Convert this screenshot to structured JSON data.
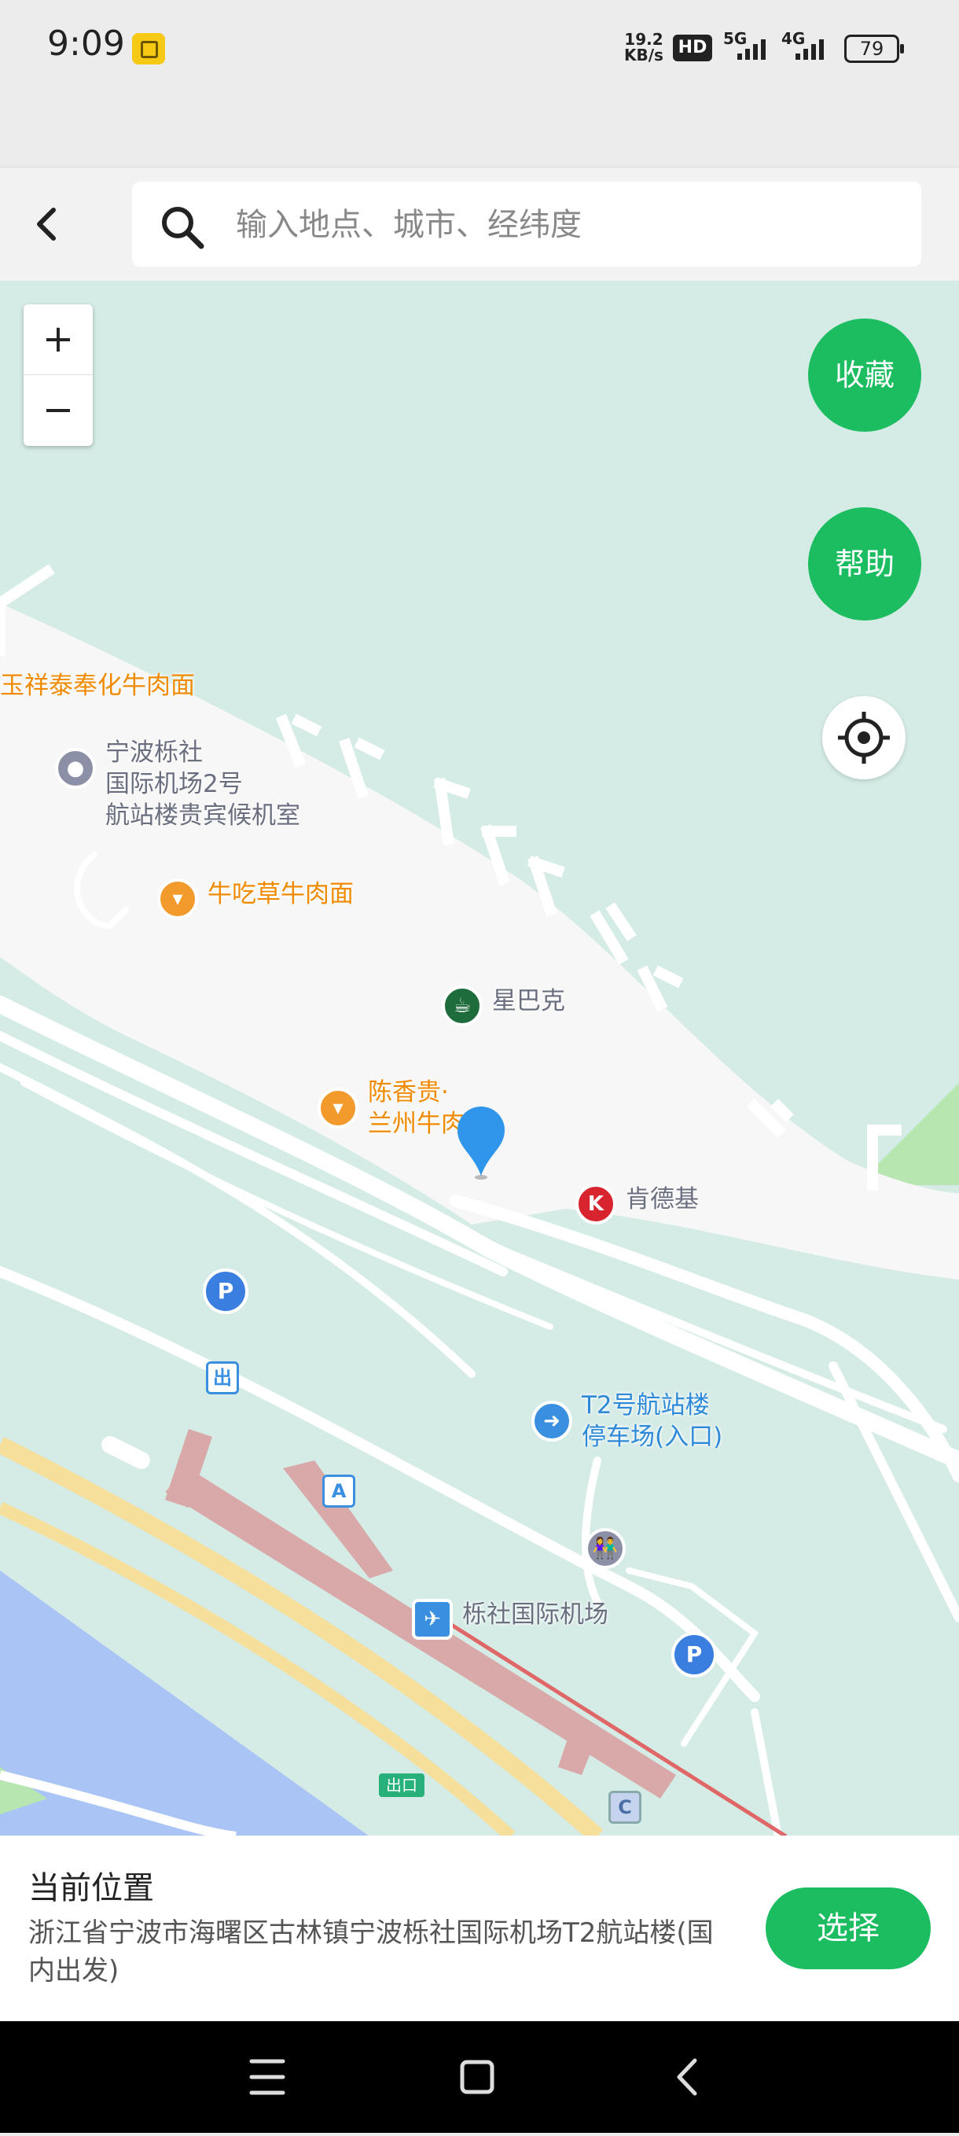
{
  "status_bar": {
    "time": "9:09",
    "net_speed_value": "19.2",
    "net_speed_unit": "KB/s",
    "hd_badge": "HD",
    "signal_1": "5G",
    "signal_2": "4G",
    "battery": "79"
  },
  "header": {
    "search_placeholder": "输入地点、城市、经纬度"
  },
  "map": {
    "zoom_in": "+",
    "zoom_out": "−",
    "favorite_label": "收藏",
    "help_label": "帮助",
    "pois": {
      "yuxiangtai": "玉祥泰奉化牛肉面",
      "vip_lounge": "宁波栎社\n国际机场2号\n航站楼贵宾候机室",
      "niuchicao": "牛吃草牛肉面",
      "starbucks": "星巴克",
      "chenxianggui": "陈香贵·\n兰州牛肉",
      "kfc": "肯德基",
      "t2_parking": "T2号航站楼\n停车场(入口)",
      "airport": "栎社国际机场"
    },
    "markers": {
      "parking": "P",
      "exit_sign": "出",
      "entrance_a": "A",
      "entrance_c": "C",
      "exit_label": "出口"
    }
  },
  "panel": {
    "title": "当前位置",
    "address": "浙江省宁波市海曙区古林镇宁波栎社国际机场T2航站楼(国内出发)",
    "select_label": "选择"
  },
  "colors": {
    "accent": "#1bbd60",
    "map_bg": "#d5ebe6",
    "road": "#ffffff",
    "highway": "#f6df9a",
    "water": "#a9c4f5",
    "platform": "#d9a9a9"
  }
}
